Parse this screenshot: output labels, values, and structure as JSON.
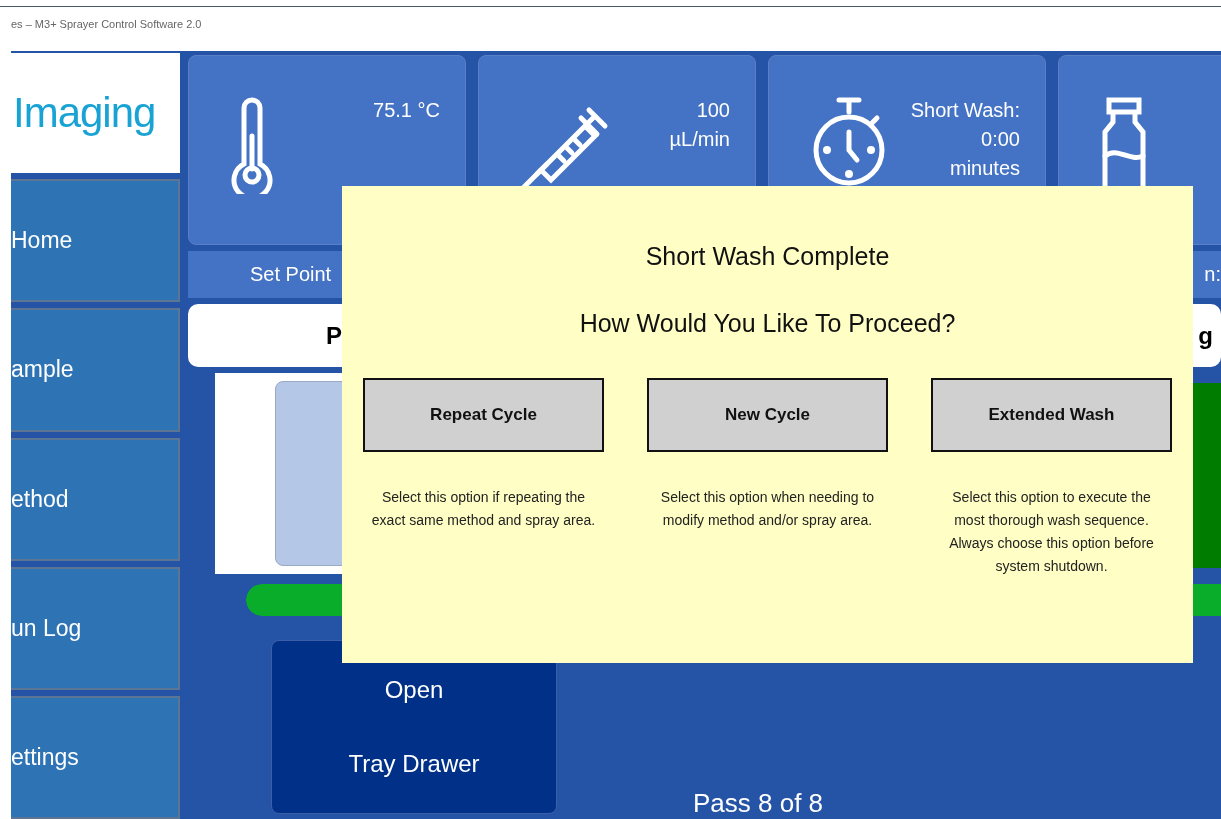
{
  "window": {
    "title": "es – M3+ Sprayer Control Software 2.0"
  },
  "logo": {
    "text": "Imaging"
  },
  "sidebar": {
    "items": [
      {
        "label": "Home"
      },
      {
        "label": "ample"
      },
      {
        "label": "ethod"
      },
      {
        "label": "un Log"
      },
      {
        "label": "ettings"
      }
    ]
  },
  "tiles": [
    {
      "kind": "temperature",
      "lines": [
        "75.1 °C"
      ]
    },
    {
      "kind": "flow",
      "lines": [
        "100",
        "µL/min"
      ]
    },
    {
      "kind": "timer",
      "lines": [
        "Short Wash:",
        "0:00",
        "minutes"
      ]
    },
    {
      "kind": "vial"
    }
  ],
  "status_bar": {
    "left": "Set Point",
    "right": "n:"
  },
  "header_bar": {
    "left": "P",
    "right": "g"
  },
  "tray_button": {
    "lines": [
      "Open",
      "Tray Drawer"
    ]
  },
  "pass_label": "Pass 8 of 8",
  "dialog": {
    "title": "Short Wash Complete",
    "question": "How Would You Like To Proceed?",
    "options": [
      {
        "label": "Repeat Cycle",
        "description": "Select this option if repeating the exact same method and spray area."
      },
      {
        "label": "New Cycle",
        "description": "Select this option when needing to modify method and/or spray area."
      },
      {
        "label": "Extended Wash",
        "description": "Select this option to execute the most thorough wash sequence.  Always choose this option before system shutdown."
      }
    ]
  }
}
